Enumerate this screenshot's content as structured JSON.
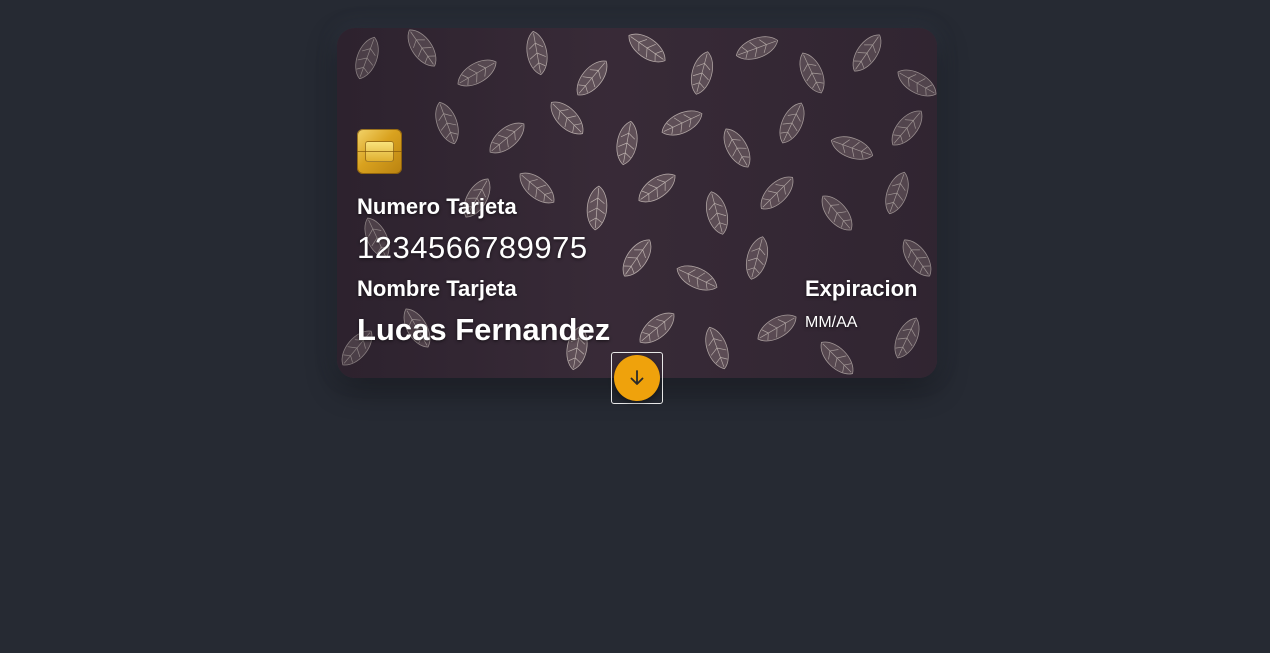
{
  "card": {
    "number_label": "Numero Tarjeta",
    "number_value": "1234566789975",
    "name_label": "Nombre Tarjeta",
    "name_value": "Lucas Fernandez",
    "expiration_label": "Expiracion",
    "expiration_value": "MM/AA",
    "chip_icon": "chip-icon"
  },
  "toggle_button": {
    "icon": "arrow-down-icon",
    "color": "#efa20c"
  },
  "colors": {
    "page_background": "#262a33",
    "text": "#ffffff"
  }
}
